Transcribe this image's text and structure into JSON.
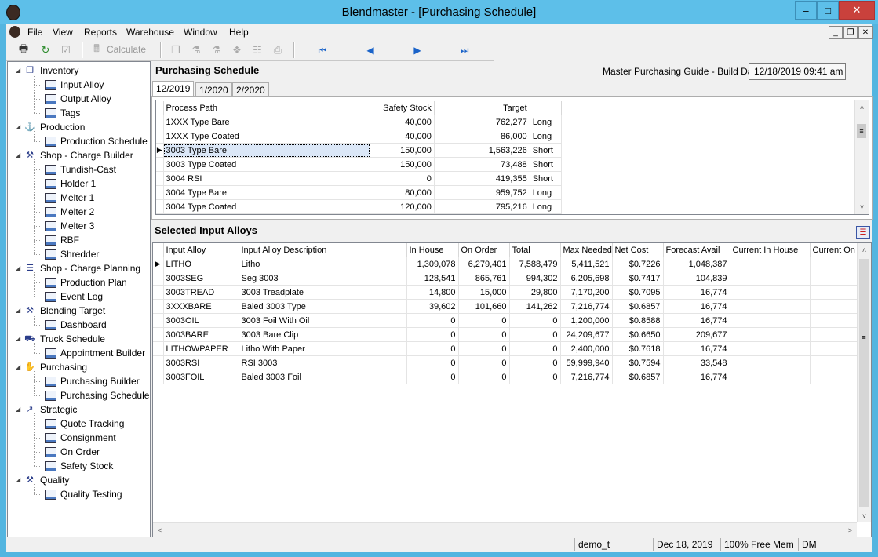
{
  "window": {
    "title": "Blendmaster - [Purchasing Schedule]"
  },
  "menu": [
    "File",
    "View",
    "Reports",
    "Warehouse",
    "Window",
    "Help"
  ],
  "toolbar": {
    "calculate_label": "Calculate"
  },
  "tree": [
    {
      "label": "Inventory",
      "icon": "inventory-icon",
      "children": [
        "Input Alloy",
        "Output Alloy",
        "Tags"
      ]
    },
    {
      "label": "Production",
      "icon": "production-icon",
      "children": [
        "Production Schedule"
      ]
    },
    {
      "label": "Shop - Charge Builder",
      "icon": "tools-icon",
      "children": [
        "Tundish-Cast",
        "Holder 1",
        "Melter 1",
        "Melter 2",
        "Melter 3",
        "RBF",
        "Shredder"
      ]
    },
    {
      "label": "Shop - Charge Planning",
      "icon": "planning-icon",
      "children": [
        "Production Plan",
        "Event Log"
      ]
    },
    {
      "label": "Blending Target",
      "icon": "tools-icon",
      "children": [
        "Dashboard"
      ]
    },
    {
      "label": "Truck Schedule",
      "icon": "truck-icon",
      "children": [
        "Appointment Builder"
      ]
    },
    {
      "label": "Purchasing",
      "icon": "handshake-icon",
      "children": [
        "Purchasing Builder",
        "Purchasing Schedule"
      ]
    },
    {
      "label": "Strategic",
      "icon": "chart-icon",
      "children": [
        "Quote Tracking",
        "Consignment",
        "On Order",
        "Safety Stock"
      ]
    },
    {
      "label": "Quality",
      "icon": "tools-icon",
      "children": [
        "Quality Testing"
      ]
    }
  ],
  "purchasing": {
    "title": "Purchasing Schedule",
    "build_label": "Master Purchasing Guide - Build Date:",
    "build_date": "12/18/2019 09:41 am",
    "tabs": [
      "12/2019",
      "1/2020",
      "2/2020"
    ],
    "columns": [
      "Process Path",
      "Safety Stock",
      "Target",
      ""
    ],
    "rows": [
      [
        "1XXX Type Bare",
        "40,000",
        "762,277",
        "Long"
      ],
      [
        "1XXX Type Coated",
        "40,000",
        "86,000",
        "Long"
      ],
      [
        "3003 Type Bare",
        "150,000",
        "1,563,226",
        "Short"
      ],
      [
        "3003 Type Coated",
        "150,000",
        "73,488",
        "Short"
      ],
      [
        "3004 RSI",
        "0",
        "419,355",
        "Short"
      ],
      [
        "3004 Type Bare",
        "80,000",
        "959,752",
        "Long"
      ],
      [
        "3004 Type Coated",
        "120,000",
        "795,216",
        "Long"
      ]
    ],
    "selected_row": 2
  },
  "alloys": {
    "title": "Selected Input Alloys",
    "columns": [
      "Input Alloy",
      "Input Alloy Description",
      "In House",
      "On Order",
      "Total",
      "Max Needed",
      "Net Cost",
      "Forecast Avail",
      "Current In House",
      "Current On O"
    ],
    "rows": [
      [
        "LITHO",
        "Litho",
        "1,309,078",
        "6,279,401",
        "7,588,479",
        "5,411,521",
        "$0.7226",
        "1,048,387"
      ],
      [
        "3003SEG",
        "Seg 3003",
        "128,541",
        "865,761",
        "994,302",
        "6,205,698",
        "$0.7417",
        "104,839"
      ],
      [
        "3003TREAD",
        "3003 Treadplate",
        "14,800",
        "15,000",
        "29,800",
        "7,170,200",
        "$0.7095",
        "16,774"
      ],
      [
        "3XXXBARE",
        "Baled 3003 Type",
        "39,602",
        "101,660",
        "141,262",
        "7,216,774",
        "$0.6857",
        "16,774"
      ],
      [
        "3003OIL",
        "3003 Foil With Oil",
        "0",
        "0",
        "0",
        "1,200,000",
        "$0.8588",
        "16,774"
      ],
      [
        "3003BARE",
        "3003 Bare Clip",
        "0",
        "0",
        "0",
        "24,209,677",
        "$0.6650",
        "209,677"
      ],
      [
        "LITHOWPAPER",
        "Litho With Paper",
        "0",
        "0",
        "0",
        "2,400,000",
        "$0.7618",
        "16,774"
      ],
      [
        "3003RSI",
        "RSI 3003",
        "0",
        "0",
        "0",
        "59,999,940",
        "$0.7594",
        "33,548"
      ],
      [
        "3003FOIL",
        "Baled 3003 Foil",
        "0",
        "0",
        "0",
        "7,216,774",
        "$0.6857",
        "16,774"
      ]
    ]
  },
  "status": {
    "user": "demo_t",
    "date": "Dec 18, 2019",
    "mem": "100% Free Mem",
    "mode": "DM"
  }
}
